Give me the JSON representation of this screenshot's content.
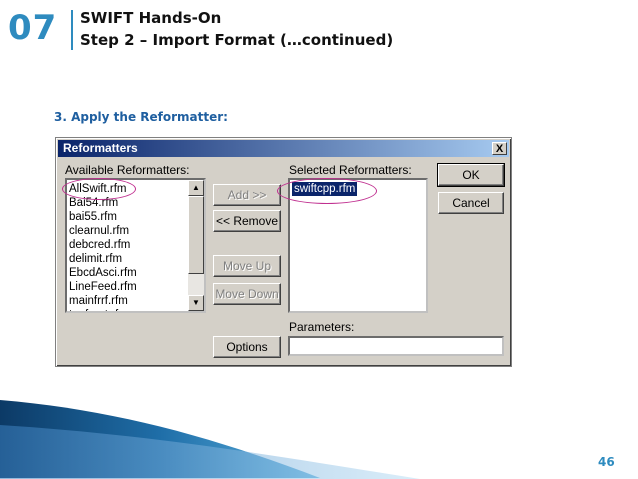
{
  "slide": {
    "number": "07",
    "title_line1": "SWIFT Hands-On",
    "title_line2": "Step 2 – Import Format (…continued)",
    "step_heading": "3. Apply the Reformatter:",
    "page_number": "46"
  },
  "dialog": {
    "title": "Reformatters",
    "close_label": "X",
    "available_label": "Available Reformatters:",
    "available_items": [
      "AllSwift.rfm",
      "Bai54.rfm",
      "bai55.rfm",
      "clearnul.rfm",
      "debcred.rfm",
      "delimit.rfm",
      "EbcdAsci.rfm",
      "LineFeed.rfm",
      "mainfrrf.rfm",
      "tagfront.rfm"
    ],
    "selected_label": "Selected Reformatters:",
    "selected_items": [
      "swiftcpp.rfm"
    ],
    "add_label": "Add >>",
    "remove_label": "<< Remove",
    "move_up_label": "Move Up",
    "move_down_label": "Move Down",
    "ok_label": "OK",
    "cancel_label": "Cancel",
    "options_label": "Options",
    "parameters_label": "Parameters:",
    "parameters_value": ""
  },
  "colors": {
    "accent": "#2e8bbf",
    "heading": "#1f5fa0",
    "titlebar_start": "#0a246a",
    "titlebar_end": "#a6caf0",
    "annotation": "#c03090"
  }
}
